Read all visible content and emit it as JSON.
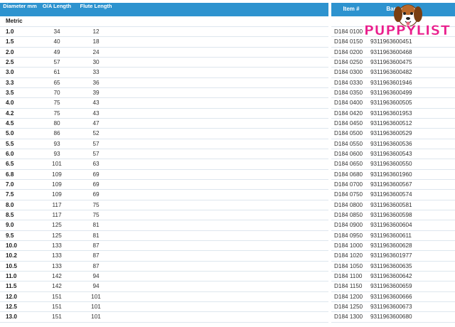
{
  "header": {
    "diameter": "Diameter mm",
    "oa_length": "O/A Length",
    "flute_length": "Flute Length",
    "item_no": "Item #",
    "barcode": "Bar"
  },
  "section": {
    "label": "Metric"
  },
  "logo": {
    "text_1": "PUPPY",
    "text_2": "LIST"
  },
  "rows": [
    {
      "diameter": "1.0",
      "oa": "34",
      "flute": "12",
      "item": "D184 0100",
      "barcode": ""
    },
    {
      "diameter": "1.5",
      "oa": "40",
      "flute": "18",
      "item": "D184 0150",
      "barcode": "9311963600451"
    },
    {
      "diameter": "2.0",
      "oa": "49",
      "flute": "24",
      "item": "D184 0200",
      "barcode": "9311963600468"
    },
    {
      "diameter": "2.5",
      "oa": "57",
      "flute": "30",
      "item": "D184 0250",
      "barcode": "9311963600475"
    },
    {
      "diameter": "3.0",
      "oa": "61",
      "flute": "33",
      "item": "D184 0300",
      "barcode": "9311963600482"
    },
    {
      "diameter": "3.3",
      "oa": "65",
      "flute": "36",
      "item": "D184 0330",
      "barcode": "9311963601946"
    },
    {
      "diameter": "3.5",
      "oa": "70",
      "flute": "39",
      "item": "D184 0350",
      "barcode": "9311963600499"
    },
    {
      "diameter": "4.0",
      "oa": "75",
      "flute": "43",
      "item": "D184 0400",
      "barcode": "9311963600505"
    },
    {
      "diameter": "4.2",
      "oa": "75",
      "flute": "43",
      "item": "D184 0420",
      "barcode": "9311963601953"
    },
    {
      "diameter": "4.5",
      "oa": "80",
      "flute": "47",
      "item": "D184 0450",
      "barcode": "9311963600512"
    },
    {
      "diameter": "5.0",
      "oa": "86",
      "flute": "52",
      "item": "D184 0500",
      "barcode": "9311963600529"
    },
    {
      "diameter": "5.5",
      "oa": "93",
      "flute": "57",
      "item": "D184 0550",
      "barcode": "9311963600536"
    },
    {
      "diameter": "6.0",
      "oa": "93",
      "flute": "57",
      "item": "D184 0600",
      "barcode": "9311963600543"
    },
    {
      "diameter": "6.5",
      "oa": "101",
      "flute": "63",
      "item": "D184 0650",
      "barcode": "9311963600550"
    },
    {
      "diameter": "6.8",
      "oa": "109",
      "flute": "69",
      "item": "D184 0680",
      "barcode": "9311963601960"
    },
    {
      "diameter": "7.0",
      "oa": "109",
      "flute": "69",
      "item": "D184 0700",
      "barcode": "9311963600567"
    },
    {
      "diameter": "7.5",
      "oa": "109",
      "flute": "69",
      "item": "D184 0750",
      "barcode": "9311963600574"
    },
    {
      "diameter": "8.0",
      "oa": "117",
      "flute": "75",
      "item": "D184 0800",
      "barcode": "9311963600581"
    },
    {
      "diameter": "8.5",
      "oa": "117",
      "flute": "75",
      "item": "D184 0850",
      "barcode": "9311963600598"
    },
    {
      "diameter": "9.0",
      "oa": "125",
      "flute": "81",
      "item": "D184 0900",
      "barcode": "9311963600604"
    },
    {
      "diameter": "9.5",
      "oa": "125",
      "flute": "81",
      "item": "D184 0950",
      "barcode": "9311963600611"
    },
    {
      "diameter": "10.0",
      "oa": "133",
      "flute": "87",
      "item": "D184 1000",
      "barcode": "9311963600628"
    },
    {
      "diameter": "10.2",
      "oa": "133",
      "flute": "87",
      "item": "D184 1020",
      "barcode": "9311963601977"
    },
    {
      "diameter": "10.5",
      "oa": "133",
      "flute": "87",
      "item": "D184 1050",
      "barcode": "9311963600635"
    },
    {
      "diameter": "11.0",
      "oa": "142",
      "flute": "94",
      "item": "D184 1100",
      "barcode": "9311963600642"
    },
    {
      "diameter": "11.5",
      "oa": "142",
      "flute": "94",
      "item": "D184 1150",
      "barcode": "9311963600659"
    },
    {
      "diameter": "12.0",
      "oa": "151",
      "flute": "101",
      "item": "D184 1200",
      "barcode": "9311963600666"
    },
    {
      "diameter": "12.5",
      "oa": "151",
      "flute": "101",
      "item": "D184 1250",
      "barcode": "9311963600673"
    },
    {
      "diameter": "13.0",
      "oa": "151",
      "flute": "101",
      "item": "D184 1300",
      "barcode": "9311963600680"
    }
  ]
}
